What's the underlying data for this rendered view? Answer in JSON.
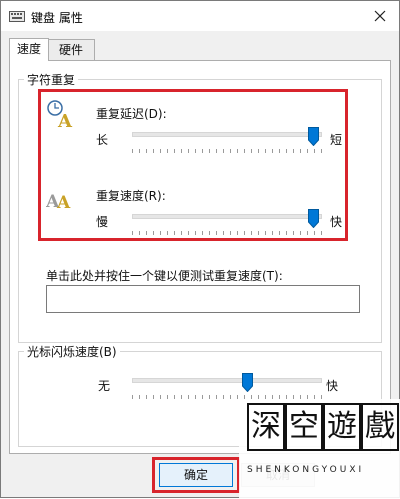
{
  "window": {
    "title": "键盘 属性"
  },
  "tabs": [
    {
      "label": "速度"
    },
    {
      "label": "硬件"
    }
  ],
  "char_repeat": {
    "legend": "字符重复",
    "delay": {
      "label": "重复延迟(D):",
      "left": "长",
      "right": "短",
      "value_fraction": 1.0
    },
    "rate": {
      "label": "重复速度(R):",
      "left": "慢",
      "right": "快",
      "value_fraction": 1.0
    },
    "test_label": "单击此处并按住一个键以便测试重复速度(T):",
    "test_value": ""
  },
  "cursor_blink": {
    "legend": "光标闪烁速度(B)",
    "left": "无",
    "right": "快",
    "value_fraction": 0.55
  },
  "buttons": {
    "ok": "确定",
    "cancel": "取消"
  },
  "watermark": {
    "chars": [
      "深",
      "空",
      "遊",
      "戲"
    ],
    "sub": "SHENKONGYOUXI"
  },
  "colors": {
    "highlight": "#d8242c",
    "thumb": "#0078d7",
    "window_bg": "#f0f0f0"
  },
  "icons": {
    "close": "close-icon",
    "delay": "clock-repeat-icon",
    "rate": "double-a-icon",
    "keyboard": "keyboard-icon"
  }
}
